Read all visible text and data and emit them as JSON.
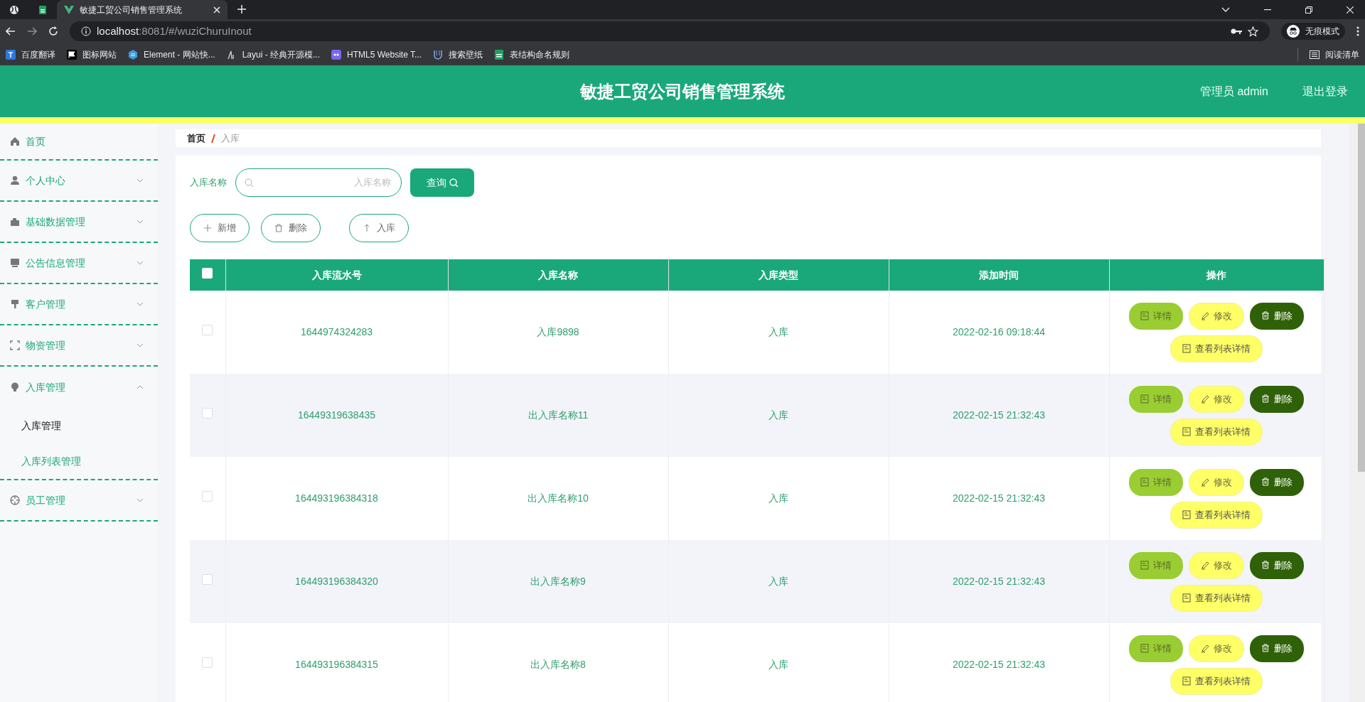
{
  "browser": {
    "tabs": [
      {
        "kind": "pinned",
        "selected": false
      },
      {
        "kind": "pinned",
        "selected": false
      },
      {
        "kind": "page",
        "title": "敏捷工贸公司销售管理系统",
        "selected": true
      }
    ],
    "url_host": "localhost",
    "url_rest": ":8081/#/wuziChuruInout",
    "incognito_label": "无痕模式",
    "bookmarks": [
      "百度翻译",
      "图标网站",
      "Element - 网站快...",
      "Layui - 经典开源模...",
      "HTML5 Website T...",
      "搜索壁纸",
      "表结构命名规则"
    ],
    "reading_list": "阅读清单"
  },
  "header": {
    "title": "敏捷工贸公司销售管理系统",
    "user": "管理员 admin",
    "logout": "退出登录"
  },
  "sidebar": {
    "items": [
      {
        "label": "首页"
      },
      {
        "label": "个人中心",
        "expanded": false
      },
      {
        "label": "基础数据管理",
        "expanded": false
      },
      {
        "label": "公告信息管理",
        "expanded": false
      },
      {
        "label": "客户管理",
        "expanded": false
      },
      {
        "label": "物资管理",
        "expanded": false
      },
      {
        "label": "入库管理",
        "expanded": true,
        "children": [
          {
            "label": "入库管理",
            "selected": true
          },
          {
            "label": "入库列表管理",
            "selected": false
          }
        ]
      },
      {
        "label": "员工管理",
        "expanded": false
      }
    ]
  },
  "breadcrumb": [
    "首页",
    "入库"
  ],
  "search": {
    "label": "入库名称",
    "placeholder": "入库名称",
    "button": "查询"
  },
  "actions": [
    {
      "kind": "add",
      "label": "新增"
    },
    {
      "kind": "delete",
      "label": "删除"
    },
    {
      "kind": "import",
      "label": "入库"
    }
  ],
  "table": {
    "select_all": false,
    "columns": [
      "入库流水号",
      "入库名称",
      "入库类型",
      "添加时间",
      "操作"
    ],
    "rows": [
      {
        "checked": false,
        "cells": [
          "1644974324283",
          "入库9898",
          "入库",
          "2022-02-16 09:18:44"
        ],
        "buttons": [
          {
            "kind": "detail",
            "label": "详情"
          },
          {
            "kind": "edit",
            "label": "修改"
          },
          {
            "kind": "delete",
            "label": "删除"
          },
          {
            "kind": "list",
            "label": "查看列表详情"
          }
        ]
      },
      {
        "checked": false,
        "cells": [
          "16449319638435",
          "出入库名称11",
          "入库",
          "2022-02-15 21:32:43"
        ],
        "buttons": [
          {
            "kind": "detail",
            "label": "详情"
          },
          {
            "kind": "edit",
            "label": "修改"
          },
          {
            "kind": "delete",
            "label": "删除"
          },
          {
            "kind": "list",
            "label": "查看列表详情"
          }
        ]
      },
      {
        "checked": false,
        "cells": [
          "164493196384318",
          "出入库名称10",
          "入库",
          "2022-02-15 21:32:43"
        ],
        "buttons": [
          {
            "kind": "detail",
            "label": "详情"
          },
          {
            "kind": "edit",
            "label": "修改"
          },
          {
            "kind": "delete",
            "label": "删除"
          },
          {
            "kind": "list",
            "label": "查看列表详情"
          }
        ]
      },
      {
        "checked": false,
        "cells": [
          "164493196384320",
          "出入库名称9",
          "入库",
          "2022-02-15 21:32:43"
        ],
        "buttons": [
          {
            "kind": "detail",
            "label": "详情"
          },
          {
            "kind": "edit",
            "label": "修改"
          },
          {
            "kind": "delete",
            "label": "删除"
          },
          {
            "kind": "list",
            "label": "查看列表详情"
          }
        ]
      },
      {
        "checked": false,
        "cells": [
          "164493196384315",
          "出入库名称8",
          "入库",
          "2022-02-15 21:32:43"
        ],
        "buttons": [
          {
            "kind": "detail",
            "label": "详情"
          },
          {
            "kind": "edit",
            "label": "修改"
          },
          {
            "kind": "delete",
            "label": "删除"
          },
          {
            "kind": "list",
            "label": "查看列表详情"
          }
        ]
      }
    ]
  }
}
